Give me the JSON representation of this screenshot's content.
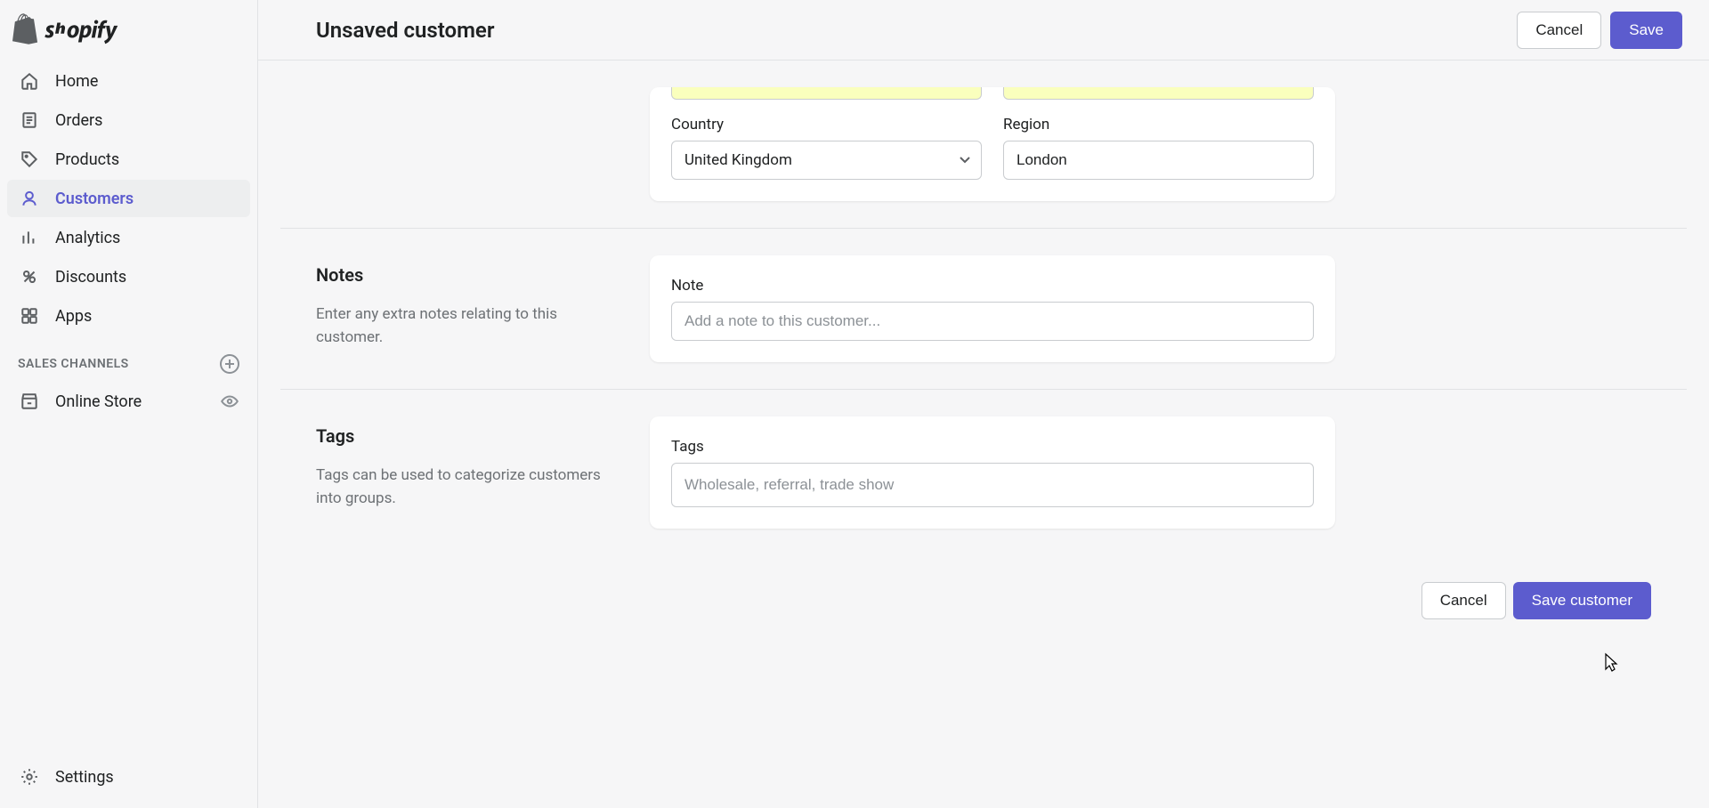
{
  "header": {
    "title": "Unsaved customer",
    "cancel_label": "Cancel",
    "save_label": "Save"
  },
  "sidebar": {
    "items": [
      {
        "label": "Home",
        "icon": "home-icon"
      },
      {
        "label": "Orders",
        "icon": "orders-icon"
      },
      {
        "label": "Products",
        "icon": "products-icon"
      },
      {
        "label": "Customers",
        "icon": "customers-icon",
        "active": true
      },
      {
        "label": "Analytics",
        "icon": "analytics-icon"
      },
      {
        "label": "Discounts",
        "icon": "discounts-icon"
      },
      {
        "label": "Apps",
        "icon": "apps-icon"
      }
    ],
    "sales_channels_title": "SALES CHANNELS",
    "online_store_label": "Online Store",
    "settings_label": "Settings"
  },
  "address": {
    "country_label": "Country",
    "country_value": "United Kingdom",
    "region_label": "Region",
    "region_value": "London"
  },
  "notes": {
    "title": "Notes",
    "description": "Enter any extra notes relating to this customer.",
    "note_label": "Note",
    "note_placeholder": "Add a note to this customer..."
  },
  "tags": {
    "title": "Tags",
    "description": "Tags can be used to categorize customers into groups.",
    "tags_label": "Tags",
    "tags_placeholder": "Wholesale, referral, trade show"
  },
  "footer": {
    "cancel_label": "Cancel",
    "save_label": "Save customer"
  }
}
